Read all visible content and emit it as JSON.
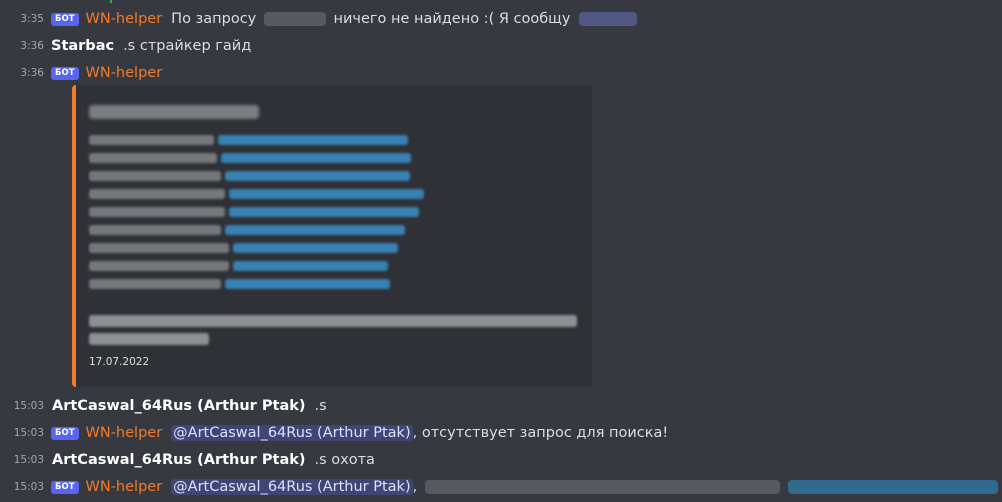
{
  "bot_tag": "БОТ",
  "messages": [
    {
      "time": "3:35",
      "author": "WN-helper",
      "is_bot": true,
      "text_before": "По запросу",
      "text_after": "ничего не найдено :( Я сообщу",
      "blurred_query": "[blurred]",
      "blurred_mention": "[blurred]"
    },
    {
      "time": "3:36",
      "author": "Starbac",
      "is_bot": false,
      "text": ".s страйкер гайд"
    },
    {
      "time": "3:36",
      "author": "WN-helper",
      "is_bot": true,
      "embed": {
        "accent": "#f47b2a",
        "title": "[blurred]",
        "footer": "[blurred]",
        "date": "17.07.2022"
      }
    },
    {
      "time": "15:03",
      "author": "ArtCaswal_64Rus (Arthur Ptak)",
      "is_bot": false,
      "text": ".s"
    },
    {
      "time": "15:03",
      "author": "WN-helper",
      "is_bot": true,
      "mention": "@ArtCaswal_64Rus (Arthur Ptak)",
      "text": ", отсутствует запрос для поиска!"
    },
    {
      "time": "15:03",
      "author": "ArtCaswal_64Rus (Arthur Ptak)",
      "is_bot": false,
      "text": ".s охота"
    },
    {
      "time": "15:03",
      "author": "WN-helper",
      "is_bot": true,
      "mention": "@ArtCaswal_64Rus (Arthur Ptak)",
      "text": ",",
      "blurred_text": "[blurred]",
      "blurred_link": "[blurred]"
    }
  ],
  "colors": {
    "background": "#36393f",
    "embed_bg": "#2f3136",
    "bot_name": "#f47b2a",
    "bot_tag": "#5865f2",
    "link": "#00b0f4",
    "mention_bg": "rgba(88,101,242,0.3)"
  }
}
